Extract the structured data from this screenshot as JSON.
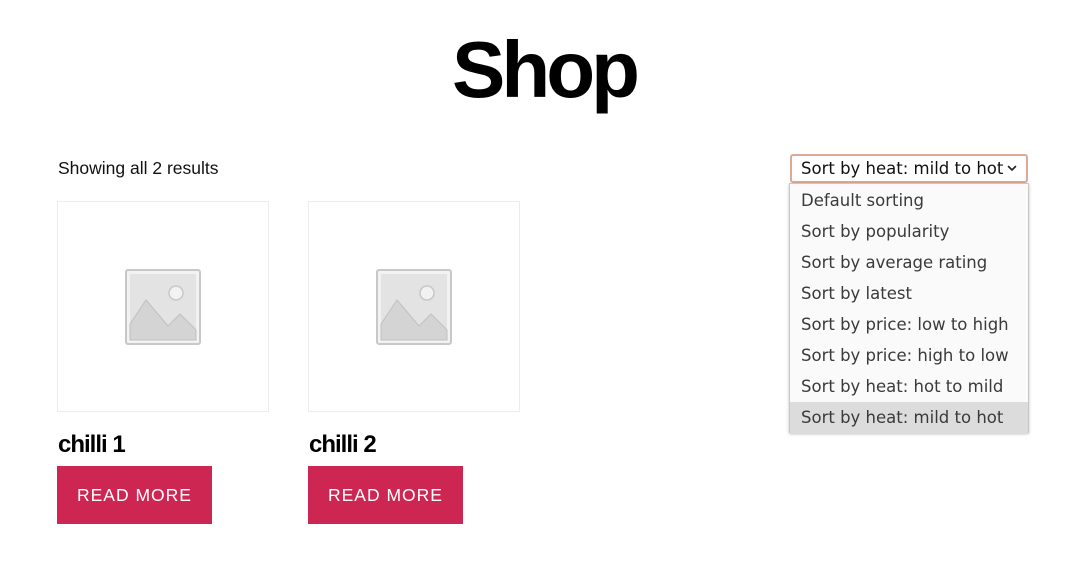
{
  "page": {
    "title": "Shop"
  },
  "shop": {
    "result_count": "Showing all 2 results",
    "sort": {
      "selected": "Sort by heat: mild to hot",
      "options": [
        "Default sorting",
        "Sort by popularity",
        "Sort by average rating",
        "Sort by latest",
        "Sort by price: low to high",
        "Sort by price: high to low",
        "Sort by heat: hot to mild",
        "Sort by heat: mild to hot"
      ],
      "selected_index": 7
    },
    "products": [
      {
        "name": "chilli 1",
        "button_label": "Read more",
        "image_icon": "placeholder-image-icon"
      },
      {
        "name": "chilli 2",
        "button_label": "Read more",
        "image_icon": "placeholder-image-icon"
      }
    ]
  },
  "colors": {
    "accent": "#cd2653",
    "select_border": "#e0a997",
    "dropdown_selected_bg": "#dcdcdc",
    "placeholder_gray": "#c8c8c8"
  }
}
